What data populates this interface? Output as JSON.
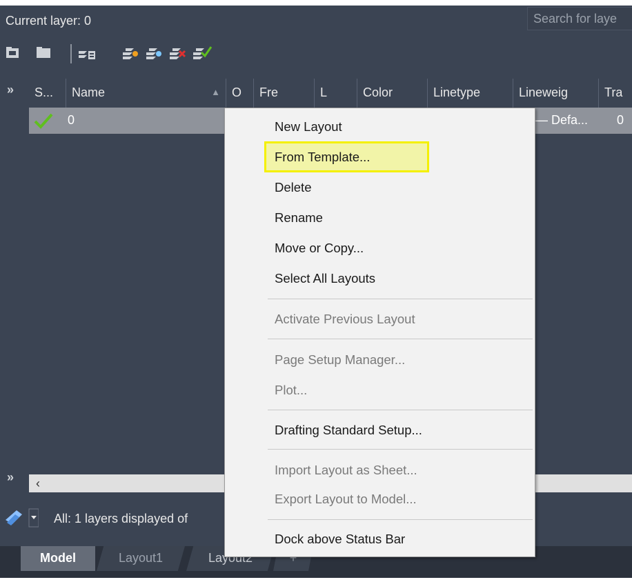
{
  "header": {
    "current_layer": "Current layer: 0",
    "search_placeholder": "Search for laye"
  },
  "toolbar": {
    "icons": [
      "new-property-filter-icon",
      "new-group-filter-icon",
      "layer-states-manager-icon",
      "new-layer-icon",
      "new-layer-frozen-icon",
      "delete-layer-icon",
      "set-current-icon"
    ]
  },
  "columns": [
    "S...",
    "Name",
    "O",
    "Fre",
    "L",
    "Color",
    "Linetype",
    "Lineweig",
    "Tra"
  ],
  "rows": [
    {
      "name": "0",
      "lineweight": "— Defa...",
      "transparency": "0"
    }
  ],
  "status": {
    "text": "All: 1 layers displayed of"
  },
  "tabs": [
    "Model",
    "Layout1",
    "Layout2",
    "+"
  ],
  "context_menu": {
    "items": [
      {
        "label": "New Layout",
        "disabled": false
      },
      {
        "label": "From Template...",
        "disabled": false,
        "highlighted": true
      },
      {
        "label": "Delete",
        "disabled": false
      },
      {
        "label": "Rename",
        "disabled": false
      },
      {
        "label": "Move or Copy...",
        "disabled": false
      },
      {
        "label": "Select All Layouts",
        "disabled": false
      },
      {
        "label": "Activate Previous Layout",
        "disabled": true
      },
      {
        "label": "Page Setup Manager...",
        "disabled": true
      },
      {
        "label": "Plot...",
        "disabled": true
      },
      {
        "label": "Drafting Standard Setup...",
        "disabled": false
      },
      {
        "label": "Import Layout as Sheet...",
        "disabled": true
      },
      {
        "label": "Export Layout to Model...",
        "disabled": true
      },
      {
        "label": "Dock above Status Bar",
        "disabled": false
      }
    ]
  },
  "colors": {
    "panel": "#3b4453",
    "highlight_border": "#f4f000",
    "check_green": "#5fbf1f",
    "delete_red": "#e03030"
  }
}
